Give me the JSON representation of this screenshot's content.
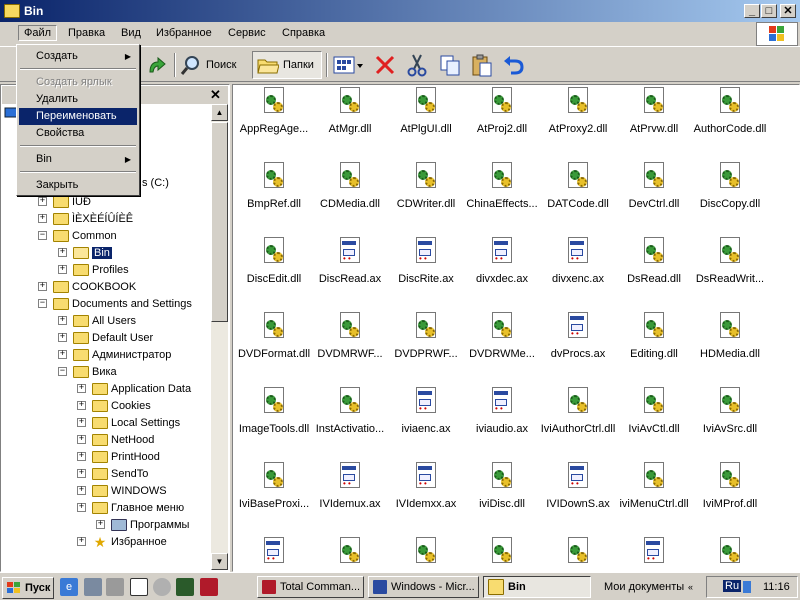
{
  "window": {
    "title": "Bin"
  },
  "menubar": [
    "Файл",
    "Правка",
    "Вид",
    "Избранное",
    "Сервис",
    "Справка"
  ],
  "toolbar": {
    "search": "Поиск",
    "folders": "Папки"
  },
  "file_menu": {
    "create": "Создать",
    "create_shortcut": "Создать ярлык",
    "delete": "Удалить",
    "rename": "Переименовать",
    "properties": "Свойства",
    "bin": "Bin",
    "close": "Закрыть"
  },
  "tree": {
    "header_partial": "s (C:)",
    "items": [
      {
        "label": "ÌÚÐ",
        "level": 1
      },
      {
        "label": "ÌÈXÈÉÍÛÍÈÊ",
        "level": 1
      },
      {
        "label": "Common",
        "level": 1
      },
      {
        "label": "Bin",
        "level": 2
      },
      {
        "label": "Profiles",
        "level": 2
      },
      {
        "label": "COOKBOOK",
        "level": 1
      },
      {
        "label": "Documents and Settings",
        "level": 1
      },
      {
        "label": "All Users",
        "level": 2
      },
      {
        "label": "Default User",
        "level": 2
      },
      {
        "label": "Администратор",
        "level": 2
      },
      {
        "label": "Вика",
        "level": 2
      },
      {
        "label": "Application Data",
        "level": 3
      },
      {
        "label": "Cookies",
        "level": 3
      },
      {
        "label": "Local Settings",
        "level": 3
      },
      {
        "label": "NetHood",
        "level": 3
      },
      {
        "label": "PrintHood",
        "level": 3
      },
      {
        "label": "SendTo",
        "level": 3
      },
      {
        "label": "WINDOWS",
        "level": 3
      },
      {
        "label": "Главное меню",
        "level": 3
      },
      {
        "label": "Программы",
        "level": 4
      },
      {
        "label": "Избранное",
        "level": 3
      }
    ]
  },
  "files": [
    {
      "name": "AppRegAge...",
      "kind": "dll"
    },
    {
      "name": "AtMgr.dll",
      "kind": "dll"
    },
    {
      "name": "AtPlgUI.dll",
      "kind": "dll"
    },
    {
      "name": "AtProj2.dll",
      "kind": "dll"
    },
    {
      "name": "AtProxy2.dll",
      "kind": "dll"
    },
    {
      "name": "AtPrvw.dll",
      "kind": "dll"
    },
    {
      "name": "AuthorCode.dll",
      "kind": "dll"
    },
    {
      "name": "BmpRef.dll",
      "kind": "dll"
    },
    {
      "name": "CDMedia.dll",
      "kind": "dll"
    },
    {
      "name": "CDWriter.dll",
      "kind": "dll"
    },
    {
      "name": "ChinaEffects...",
      "kind": "dll"
    },
    {
      "name": "DATCode.dll",
      "kind": "dll"
    },
    {
      "name": "DevCtrl.dll",
      "kind": "dll"
    },
    {
      "name": "DiscCopy.dll",
      "kind": "dll"
    },
    {
      "name": "DiscEdit.dll",
      "kind": "dll"
    },
    {
      "name": "DiscRead.ax",
      "kind": "ax"
    },
    {
      "name": "DiscRite.ax",
      "kind": "ax"
    },
    {
      "name": "divxdec.ax",
      "kind": "ax"
    },
    {
      "name": "divxenc.ax",
      "kind": "ax"
    },
    {
      "name": "DsRead.dll",
      "kind": "dll"
    },
    {
      "name": "DsReadWrit...",
      "kind": "dll"
    },
    {
      "name": "DVDFormat.dll",
      "kind": "dll"
    },
    {
      "name": "DVDMRWF...",
      "kind": "dll"
    },
    {
      "name": "DVDPRWF...",
      "kind": "dll"
    },
    {
      "name": "DVDRWMe...",
      "kind": "dll"
    },
    {
      "name": "dvProcs.ax",
      "kind": "ax"
    },
    {
      "name": "Editing.dll",
      "kind": "dll"
    },
    {
      "name": "HDMedia.dll",
      "kind": "dll"
    },
    {
      "name": "ImageTools.dll",
      "kind": "dll"
    },
    {
      "name": "InstActivatio...",
      "kind": "dll"
    },
    {
      "name": "iviaenc.ax",
      "kind": "ax"
    },
    {
      "name": "iviaudio.ax",
      "kind": "ax"
    },
    {
      "name": "IviAuthorCtrl.dll",
      "kind": "dll"
    },
    {
      "name": "IviAvCtl.dll",
      "kind": "dll"
    },
    {
      "name": "IviAvSrc.dll",
      "kind": "dll"
    },
    {
      "name": "IviBaseProxi...",
      "kind": "dll"
    },
    {
      "name": "IVIdemux.ax",
      "kind": "ax"
    },
    {
      "name": "IVIdemxx.ax",
      "kind": "ax"
    },
    {
      "name": "iviDisc.dll",
      "kind": "dll"
    },
    {
      "name": "IVIDownS.ax",
      "kind": "ax"
    },
    {
      "name": "iviMenuCtrl.dll",
      "kind": "dll"
    },
    {
      "name": "IviMProf.dll",
      "kind": "dll"
    },
    {
      "name": "",
      "kind": "ax"
    },
    {
      "name": "",
      "kind": "dll"
    },
    {
      "name": "",
      "kind": "dll"
    },
    {
      "name": "",
      "kind": "dll"
    },
    {
      "name": "",
      "kind": "dll"
    },
    {
      "name": "",
      "kind": "ax"
    },
    {
      "name": "",
      "kind": "dll"
    }
  ],
  "taskbar": {
    "start": "Пуск",
    "tasks": [
      "Total Comman...",
      "Windows - Micr...",
      "Bin"
    ],
    "address_label": "Мои документы",
    "lang": "Ru",
    "clock": "11:16"
  },
  "colors": {
    "titlebar": "#0a246a",
    "highlight": "#0a246a",
    "face": "#d4d0c8"
  }
}
